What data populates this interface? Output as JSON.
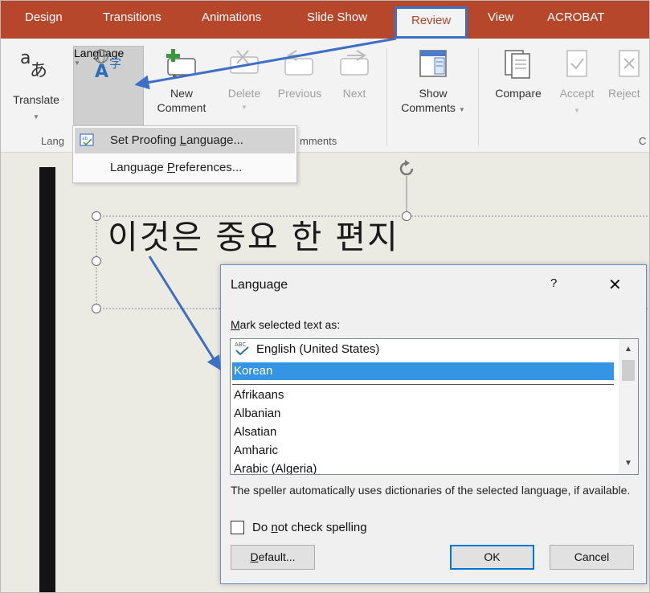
{
  "tabs": [
    {
      "label": "Design"
    },
    {
      "label": "Transitions"
    },
    {
      "label": "Animations"
    },
    {
      "label": "Slide Show"
    },
    {
      "label": "Review",
      "active": true
    },
    {
      "label": "View"
    },
    {
      "label": "ACROBAT"
    }
  ],
  "ribbon": {
    "translate": "Translate",
    "language": "Language",
    "new_comment_1": "New",
    "new_comment_2": "Comment",
    "delete": "Delete",
    "previous": "Previous",
    "next": "Next",
    "show_comments_1": "Show",
    "show_comments_2": "Comments",
    "compare": "Compare",
    "accept": "Accept",
    "reject": "Reject",
    "group_language": "Lang",
    "group_comments": "mments",
    "group_compare": "C"
  },
  "menu": {
    "set_proofing_pre": "Set Proofing ",
    "set_proofing_ul": "L",
    "set_proofing_post": "anguage...",
    "lang_prefs_pre": "Language ",
    "lang_prefs_ul": "P",
    "lang_prefs_post": "references..."
  },
  "slide": {
    "title": "이것은 중요 한 편지"
  },
  "dialog": {
    "title": "Language",
    "help": "?",
    "close": "✕",
    "mark_label_ul": "M",
    "mark_label_rest": "ark selected text as:",
    "languages_top": [
      "English (United States)",
      "Korean"
    ],
    "languages": [
      "Afrikaans",
      "Albanian",
      "Alsatian",
      "Amharic",
      "Arabic (Algeria)"
    ],
    "selected": "Korean",
    "info": "The speller automatically uses dictionaries of the selected language, if available.",
    "no_check_pre": "Do ",
    "no_check_ul": "n",
    "no_check_post": "ot check spelling",
    "default_ul": "D",
    "default_rest": "efault...",
    "ok": "OK",
    "cancel": "Cancel"
  },
  "colors": {
    "tab_bar": "#b7472a",
    "annotation": "#3d6fc6",
    "selection": "#3595e5"
  }
}
